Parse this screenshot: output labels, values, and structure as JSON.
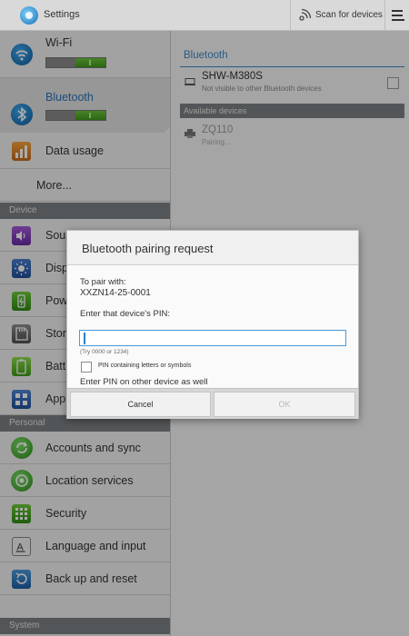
{
  "header": {
    "title": "Settings",
    "scan_label": "Scan for devices",
    "app_icon": "settings-gear-icon",
    "scan_icon": "scan-radar-icon",
    "overflow_icon": "overflow-menu-icon"
  },
  "sidebar": {
    "wifi_label": "Wi-Fi",
    "bluetooth_label": "Bluetooth",
    "data_usage_label": "Data usage",
    "more_label": "More...",
    "device_section": "Device",
    "device_items": [
      "Sou",
      "Disp",
      "Pow",
      "Stor",
      "Batt",
      "App"
    ],
    "personal_section": "Personal",
    "personal_items": [
      "Accounts and sync",
      "Location services",
      "Security",
      "Language and input",
      "Back up and reset"
    ],
    "system_section": "System",
    "wifi_on": true,
    "bluetooth_on": true
  },
  "bluetooth_panel": {
    "title": "Bluetooth",
    "my_device_name": "SHW-M380S",
    "my_device_status": "Not visible to other Bluetooth devices",
    "available_header": "Available devices",
    "available_device_name": "ZQ110",
    "available_device_status": "Pairing..."
  },
  "dialog": {
    "title": "Bluetooth pairing request",
    "pair_with_label": "To pair with:",
    "device_id": "XXZN14-25-0001",
    "enter_pin_label": "Enter that device's PIN:",
    "pin_value": "",
    "hint": "(Try 0000 or 1234)",
    "checkbox_label": "PIN containing letters or symbols",
    "checkbox_checked": false,
    "other_device_note": "Enter PIN on other device as well",
    "cancel_label": "Cancel",
    "ok_label": "OK"
  },
  "colors": {
    "accent_blue": "#3a88c7",
    "toggle_green": "#5bb32e",
    "section_header": "#7d8083"
  }
}
